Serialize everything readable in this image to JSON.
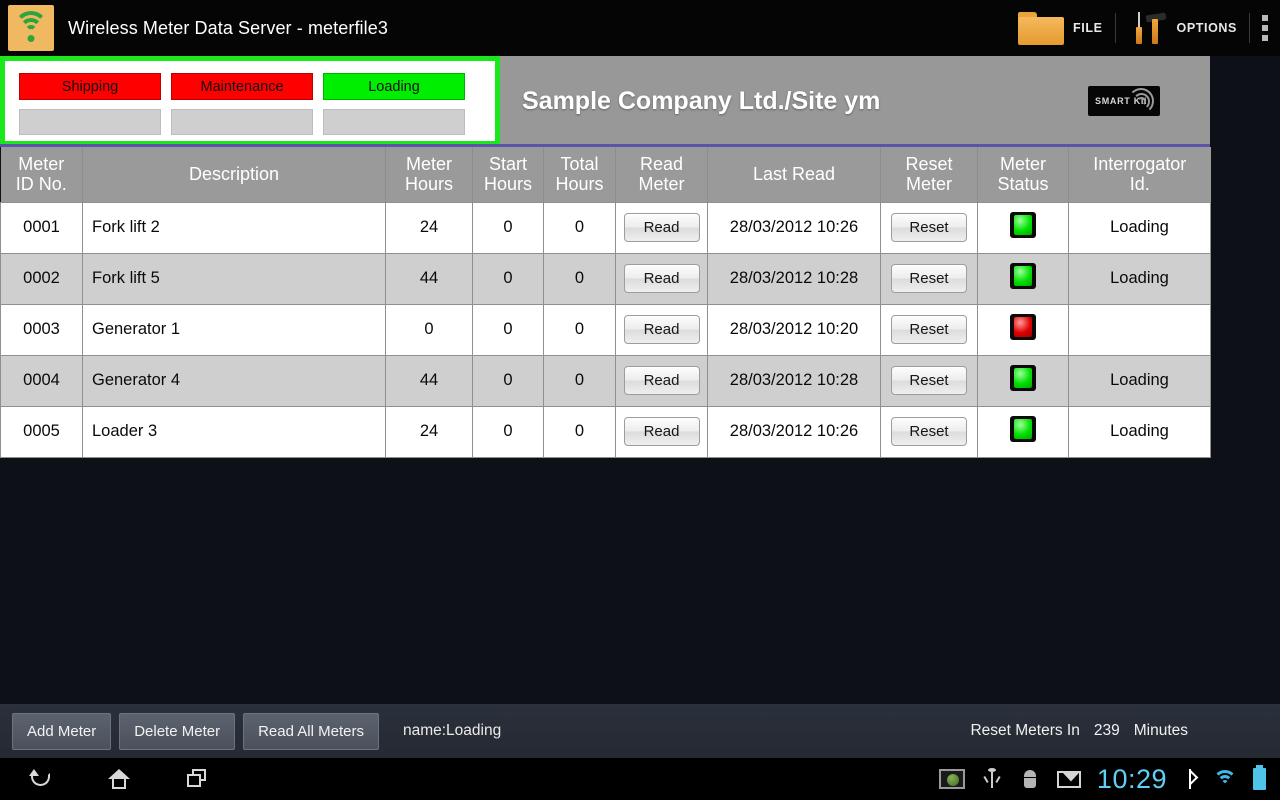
{
  "titlebar": {
    "app_icon": "wifi-icon",
    "title": "Wireless Meter Data Server - meterfile3",
    "file_label": "FILE",
    "options_label": "OPTIONS",
    "overflow_icon": "overflow-menu-icon"
  },
  "status_panel": {
    "buttons": [
      {
        "label": "Shipping",
        "color": "#ff0000",
        "active": false
      },
      {
        "label": "Maintenance",
        "color": "#ff0000",
        "active": false
      },
      {
        "label": "Loading",
        "color": "#00ee00",
        "active": true
      }
    ]
  },
  "banner": {
    "title": "Sample Company Ltd./Site ym",
    "logo_text": "SMART Kii"
  },
  "table": {
    "headers": [
      "Meter\nID No.",
      "Description",
      "Meter\nHours",
      "Start\nHours",
      "Total\nHours",
      "Read\nMeter",
      "Last Read",
      "Reset\nMeter",
      "Meter\nStatus",
      "Interrogator\nId."
    ],
    "header_lines": [
      [
        "Meter",
        "ID No."
      ],
      [
        "Description",
        ""
      ],
      [
        "Meter",
        "Hours"
      ],
      [
        "Start",
        "Hours"
      ],
      [
        "Total",
        "Hours"
      ],
      [
        "Read",
        "Meter"
      ],
      [
        "Last Read",
        ""
      ],
      [
        "Reset",
        "Meter"
      ],
      [
        "Meter",
        "Status"
      ],
      [
        "Interrogator",
        "Id."
      ]
    ],
    "read_button_label": "Read",
    "reset_button_label": "Reset",
    "rows": [
      {
        "id": "0001",
        "description": "Fork lift 2",
        "meter_hours": "24",
        "start_hours": "0",
        "total_hours": "0",
        "last_read": "28/03/2012 10:26",
        "status": "green",
        "interrogator_id": "Loading"
      },
      {
        "id": "0002",
        "description": "Fork lift 5",
        "meter_hours": "44",
        "start_hours": "0",
        "total_hours": "0",
        "last_read": "28/03/2012 10:28",
        "status": "green",
        "interrogator_id": "Loading"
      },
      {
        "id": "0003",
        "description": "Generator 1",
        "meter_hours": "0",
        "start_hours": "0",
        "total_hours": "0",
        "last_read": "28/03/2012 10:20",
        "status": "red",
        "interrogator_id": ""
      },
      {
        "id": "0004",
        "description": "Generator 4",
        "meter_hours": "44",
        "start_hours": "0",
        "total_hours": "0",
        "last_read": "28/03/2012 10:28",
        "status": "green",
        "interrogator_id": "Loading"
      },
      {
        "id": "0005",
        "description": "Loader 3",
        "meter_hours": "24",
        "start_hours": "0",
        "total_hours": "0",
        "last_read": "28/03/2012 10:26",
        "status": "green",
        "interrogator_id": "Loading"
      }
    ]
  },
  "bottombar": {
    "add_meter_label": "Add Meter",
    "delete_meter_label": "Delete Meter",
    "read_all_label": "Read All Meters",
    "name_status": "name:Loading",
    "reset_prefix": "Reset Meters In",
    "reset_value": "239",
    "reset_suffix": "Minutes"
  },
  "navbar": {
    "back_icon": "back-icon",
    "home_icon": "home-icon",
    "recents_icon": "recent-apps-icon",
    "screenshot_icon": "screenshot-icon",
    "usb_icon": "usb-icon",
    "android_icon": "android-icon",
    "mail_icon": "mail-icon",
    "clock": "10:29",
    "bluetooth_icon": "bluetooth-icon",
    "wifi_icon": "wifi-icon",
    "battery_icon": "battery-icon"
  }
}
